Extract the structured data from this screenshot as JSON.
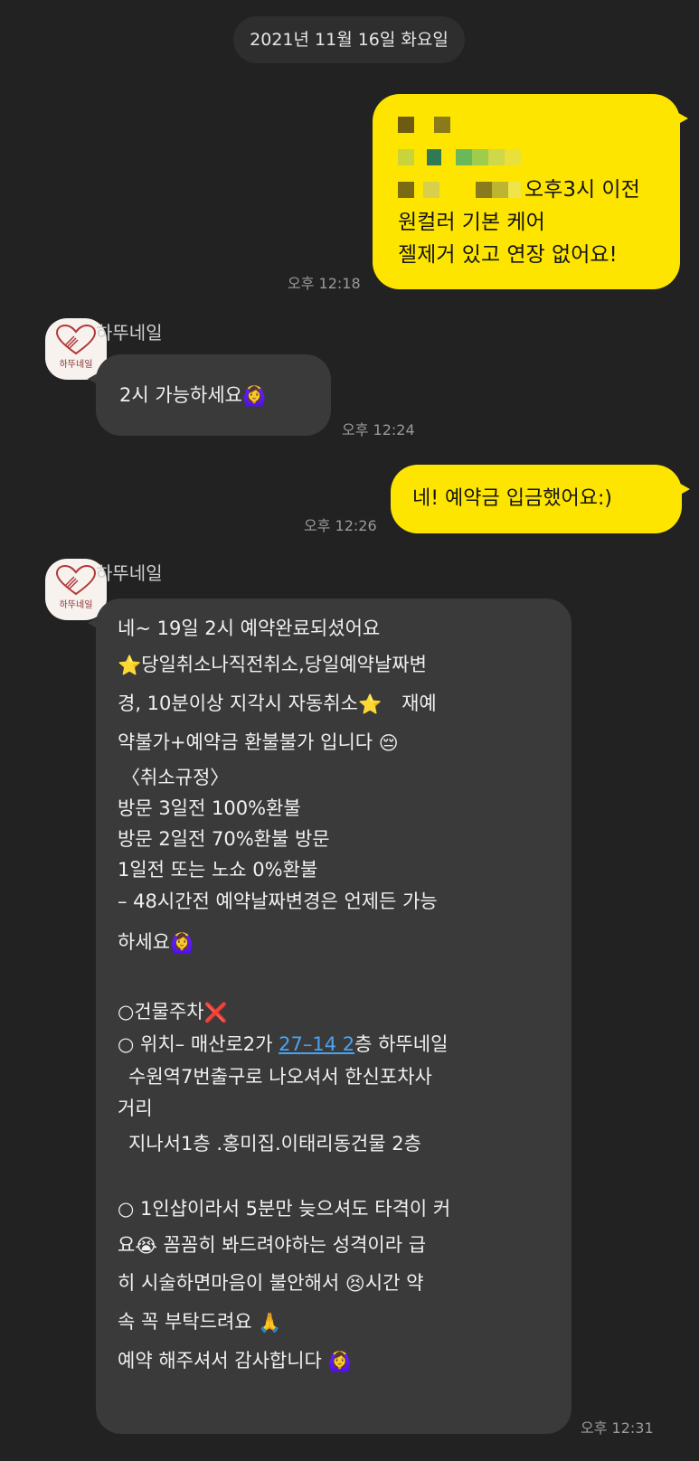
{
  "date_divider": "2021년 11월 16일 화요일",
  "sender_name": "하뚜네일",
  "avatar_text": "하뚜네일",
  "messages": {
    "m1": {
      "lines": [
        "오후3시 이전",
        "원컬러 기본 케어",
        "젤제거 있고 연장 없어요!"
      ],
      "time": "오후 12:18"
    },
    "m2": {
      "text": "2시 가능하세요",
      "time": "오후 12:24"
    },
    "m3": {
      "text": "네! 예약금 입금했어요:)",
      "time": "오후 12:26"
    },
    "m4": {
      "time": "오후 12:31",
      "lines": {
        "l1": "네~ 19일 2시  예약완료되셨어요",
        "l2": "당일취소나직전취소,당일예약날짜변",
        "l3a": "경, 10분이상 지각시 자동취소",
        "l3b": "재예",
        "l4": "약불가+예약금 환불불가 입니다",
        "l5": "〈취소규정〉",
        "l6": "방문 3일전 100%환불",
        "l7": "방문 2일전 70%환불 방문",
        "l8": "1일전 또는 노쇼 0%환불",
        "l9": "– 48시간전 예약날짜변경은 언제든 가능",
        "l10": "하세요",
        "l11": "○건물주차",
        "l12a": "○ 위치– 매산로2가 ",
        "l12link": "27–14 2",
        "l12b": "층 하뚜네일",
        "l13": "수원역7번출구로 나오셔서 한신포차사",
        "l14": "거리",
        "l15": "지나서1층 .홍미집.이태리동건물 2층",
        "l16": "○ 1인샵이라서 5분만 늦으셔도 타격이 커",
        "l17a": "요",
        "l17b": "  꼼꼼히 봐드려야하는 성격이라 급",
        "l18a": "히 시술하면마음이 불안해서 ",
        "l18b": "시간 약",
        "l19": "속 꼭 부탁드려요 ",
        "l20": "예약 해주셔서 감사합니다 "
      }
    }
  },
  "colors": {
    "background": "#222222",
    "my_bubble": "#fee500",
    "their_bubble": "#3a3a3a",
    "link": "#4aa3f0"
  }
}
